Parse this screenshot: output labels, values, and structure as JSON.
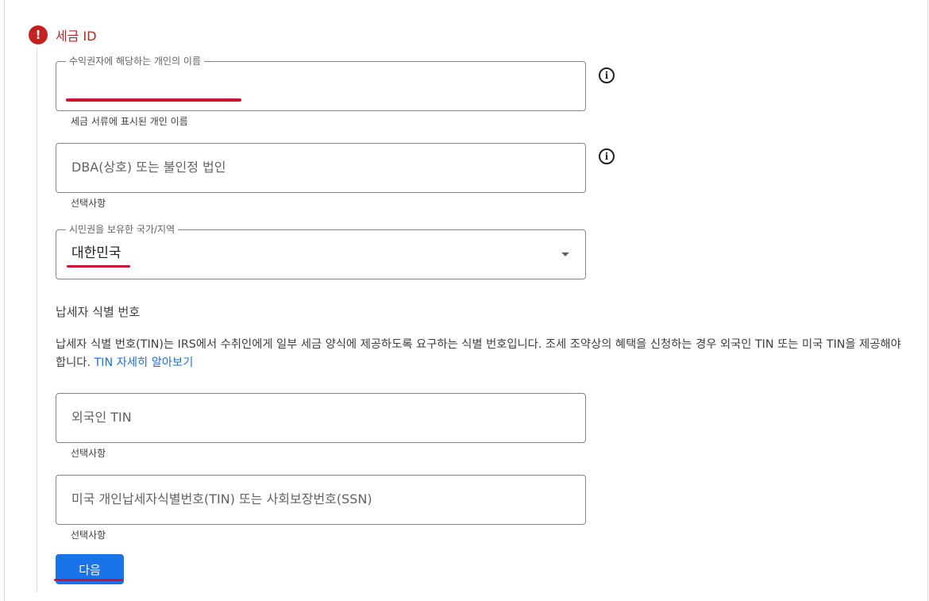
{
  "section": {
    "title": "세금 ID",
    "error_icon": "error-exclamation-icon"
  },
  "fields": {
    "beneficiary_name": {
      "label": "수익권자에 해당하는 개인의 이름",
      "value": "",
      "helper": "세금 서류에 표시된 개인 이름"
    },
    "dba": {
      "placeholder": "DBA(상호) 또는 불인정 법인",
      "helper": "선택사항"
    },
    "citizenship": {
      "label": "시민권을 보유한 국가/지역",
      "value": "대한민국"
    },
    "foreign_tin": {
      "placeholder": "외국인 TIN",
      "helper": "선택사항"
    },
    "us_tin": {
      "placeholder": "미국 개인납세자식별번호(TIN) 또는 사회보장번호(SSN)",
      "helper": "선택사항"
    }
  },
  "tin_section": {
    "heading": "납세자 식별 번호",
    "description": "납세자 식별 번호(TIN)는 IRS에서 수취인에게 일부 세금 양식에 제공하도록 요구하는 식별 번호입니다. 조세 조약상의 혜택을 신청하는 경우 외국인 TIN 또는 미국 TIN을 제공해야 합니다. ",
    "link": "TIN 자세히 알아보기"
  },
  "buttons": {
    "next": "다음"
  },
  "icons": {
    "info": "i"
  },
  "colors": {
    "error": "#c5221f",
    "primary": "#1a73e8",
    "annotation": "#d0112b"
  }
}
